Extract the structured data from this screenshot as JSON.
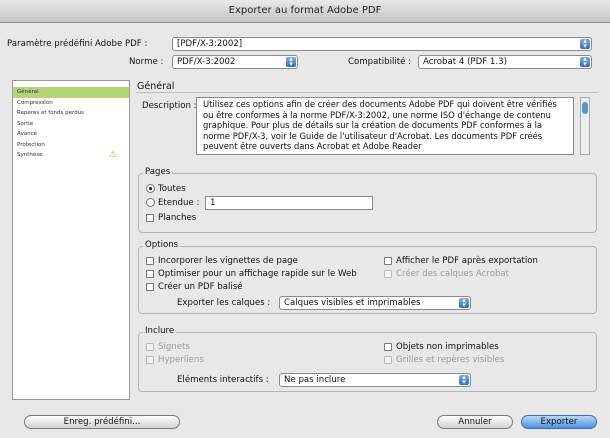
{
  "window": {
    "title": "Exporter au format Adobe PDF"
  },
  "preset": {
    "label": "Paramètre prédéfini Adobe PDF :",
    "value": "[PDF/X-3:2002]"
  },
  "norme": {
    "label": "Norme :",
    "value": "PDF/X-3:2002"
  },
  "compat": {
    "label": "Compatibilité :",
    "value": "Acrobat 4 (PDF 1.3)"
  },
  "sidebar": {
    "items": [
      {
        "label": "Général"
      },
      {
        "label": "Compression"
      },
      {
        "label": "Repères et fonds perdus"
      },
      {
        "label": "Sortie"
      },
      {
        "label": "Avancé"
      },
      {
        "label": "Protection"
      },
      {
        "label": "Synthèse"
      }
    ]
  },
  "general": {
    "heading": "Général",
    "description_label": "Description :",
    "description_text": "Utilisez ces options afin de créer des documents Adobe PDF qui doivent être vérifiés ou être conformes à la norme PDF/X-3:2002, une norme ISO d'échange de contenu graphique. Pour plus de détails sur la création de documents PDF conformes à la norme PDF/X-3, voir le Guide de l'utilisateur d'Acrobat. Les documents PDF créés peuvent être ouverts dans Acrobat et Adobe Reader"
  },
  "pages": {
    "title": "Pages",
    "all": "Toutes",
    "range": "Etendue :",
    "range_value": "1",
    "spreads": "Planches"
  },
  "options": {
    "title": "Options",
    "thumbs": "Incorporer les vignettes de page",
    "fastweb": "Optimiser pour un affichage rapide sur le Web",
    "tagged": "Créer un PDF balisé",
    "viewafter": "Afficher le PDF après exportation",
    "layers": "Créer des calques Acrobat",
    "export_layers_label": "Exporter les calques :",
    "export_layers_value": "Calques visibles et imprimables"
  },
  "include": {
    "title": "Inclure",
    "bookmarks": "Signets",
    "hyperlinks": "Hyperliens",
    "nonprint": "Objets non imprimables",
    "guides": "Grilles et repères visibles",
    "interactive_label": "Eléments interactifs :",
    "interactive_value": "Ne pas inclure"
  },
  "buttons": {
    "save_preset": "Enreg. prédéfini...",
    "cancel": "Annuler",
    "export": "Exporter"
  }
}
